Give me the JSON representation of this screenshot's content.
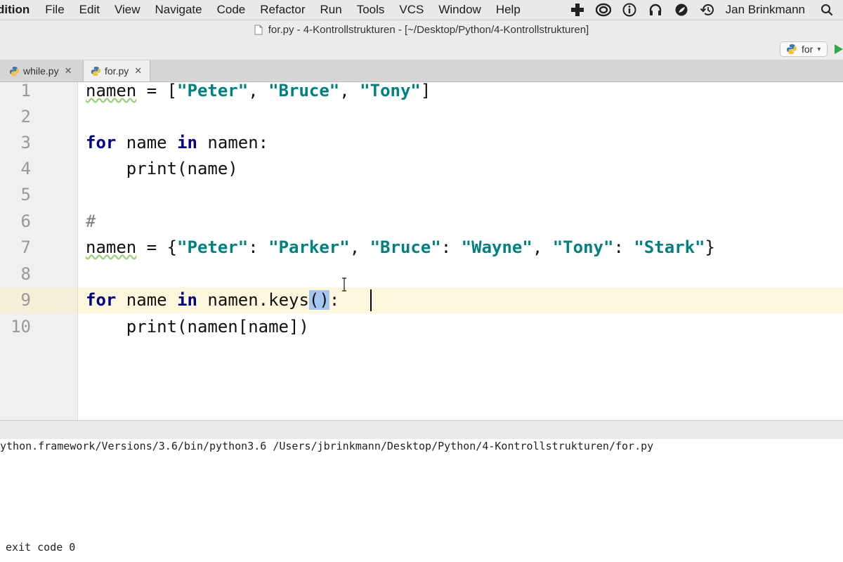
{
  "menubar": {
    "app_name": "dition",
    "items": [
      "File",
      "Edit",
      "View",
      "Navigate",
      "Code",
      "Refactor",
      "Run",
      "Tools",
      "VCS",
      "Window",
      "Help"
    ],
    "user": "Jan Brinkmann"
  },
  "window": {
    "title": "for.py - 4-Kontrollstrukturen - [~/Desktop/Python/4-Kontrollstrukturen]"
  },
  "toolbar": {
    "run_config": "for"
  },
  "tabs": [
    {
      "label": "while.py",
      "active": false
    },
    {
      "label": "for.py",
      "active": true
    }
  ],
  "editor": {
    "line_numbers": [
      "1",
      "2",
      "3",
      "4",
      "5",
      "6",
      "7",
      "8",
      "9",
      "10"
    ],
    "current_line": "9",
    "lines": {
      "l1": {
        "var": "namen",
        "op": " = [",
        "s1": "\"Peter\"",
        "c1": ", ",
        "s2": "\"Bruce\"",
        "c2": ", ",
        "s3": "\"Tony\"",
        "end": "]"
      },
      "l3": {
        "kw1": "for",
        "mid": " name ",
        "kw2": "in",
        "rest": " namen:"
      },
      "l4": {
        "text": "    print(name)"
      },
      "l6": {
        "comment": "#"
      },
      "l7": {
        "var": "namen",
        "op": " = {",
        "s1": "\"Peter\"",
        "c1": ": ",
        "s2": "\"Parker\"",
        "c2": ", ",
        "s3": "\"Bruce\"",
        "c3": ": ",
        "s4": "\"Wayne\"",
        "c4": ", ",
        "s5": "\"Tony\"",
        "c5": ": ",
        "s6": "\"Stark\"",
        "end": "}"
      },
      "l9": {
        "kw1": "for",
        "mid": " name ",
        "kw2": "in",
        "rest": " namen.keys",
        "sel": "()",
        "end": ":"
      },
      "l10": {
        "text": "    print(namen[name])"
      }
    }
  },
  "console": {
    "command": "ython.framework/Versions/3.6/bin/python3.6 /Users/jbrinkmann/Desktop/Python/4-Kontrollstrukturen/for.py",
    "exit": "exit code 0"
  }
}
